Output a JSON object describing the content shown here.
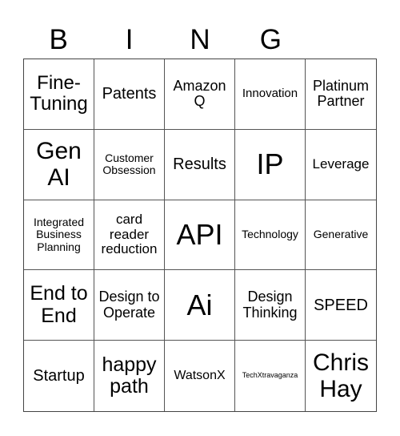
{
  "header": {
    "letters": [
      "B",
      "I",
      "N",
      "G",
      ""
    ]
  },
  "cells": [
    {
      "text": "Fine-Tuning",
      "size": 24
    },
    {
      "text": "Patents",
      "size": 20
    },
    {
      "text": "Amazon Q",
      "size": 18
    },
    {
      "text": "Innovation",
      "size": 15
    },
    {
      "text": "Platinum Partner",
      "size": 18
    },
    {
      "text": "Gen AI",
      "size": 30
    },
    {
      "text": "Customer Obsession",
      "size": 14
    },
    {
      "text": "Results",
      "size": 20
    },
    {
      "text": "IP",
      "size": 36
    },
    {
      "text": "Leverage",
      "size": 17
    },
    {
      "text": "Integrated Business Planning",
      "size": 14
    },
    {
      "text": "card reader reduction",
      "size": 17
    },
    {
      "text": "API",
      "size": 36
    },
    {
      "text": "Technology",
      "size": 14
    },
    {
      "text": "Generative",
      "size": 14
    },
    {
      "text": "End to End",
      "size": 25
    },
    {
      "text": "Design to Operate",
      "size": 18
    },
    {
      "text": "Ai",
      "size": 36
    },
    {
      "text": "Design Thinking",
      "size": 18
    },
    {
      "text": "SPEED",
      "size": 20
    },
    {
      "text": "Startup",
      "size": 20
    },
    {
      "text": "happy path",
      "size": 25
    },
    {
      "text": "WatsonX",
      "size": 16
    },
    {
      "text": "TechXtravaganza",
      "size": 9
    },
    {
      "text": "Chris Hay",
      "size": 30
    }
  ]
}
